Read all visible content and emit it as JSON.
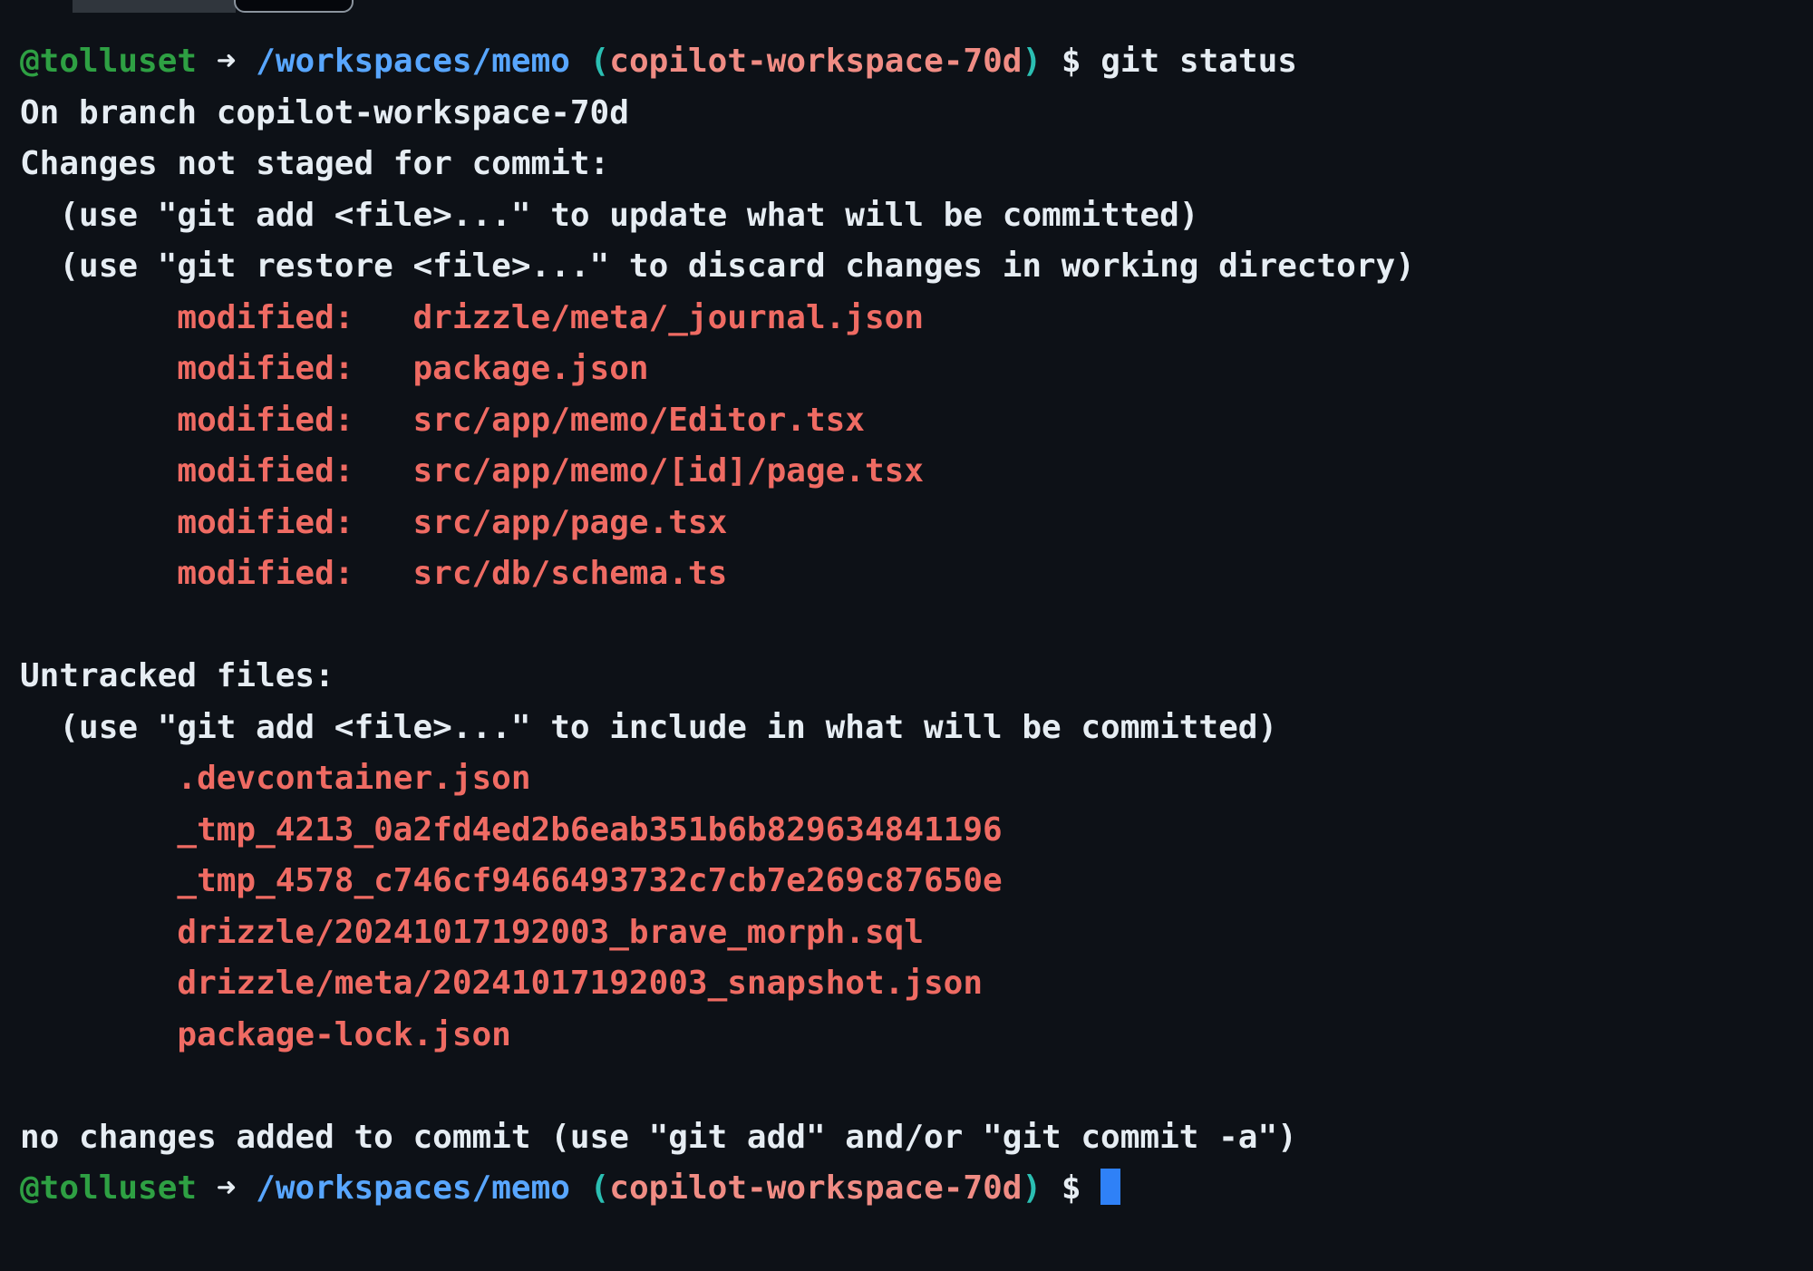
{
  "window": {
    "tabs": [
      {
        "name": "tab-inactive",
        "label": ""
      },
      {
        "name": "tab-active",
        "label": ""
      }
    ]
  },
  "terminal": {
    "background_color": "#0d1117",
    "colors": {
      "user": "#2ea043",
      "path": "#58a6ff",
      "paren": "#2bbfb3",
      "branch": "#f08c84",
      "text": "#e6edf3",
      "file": "#ef6b63",
      "cursor": "#2f81f7"
    },
    "prompt": {
      "user": "@tolluset",
      "arrow": "➜",
      "path": "/workspaces/memo",
      "paren_open": "(",
      "branch": "copilot-workspace-70d",
      "paren_close": ")",
      "dollar": "$"
    },
    "command": "git status",
    "output": {
      "branch_line": "On branch copilot-workspace-70d",
      "changes_header": "Changes not staged for commit:",
      "hint_add_update": "  (use \"git add <file>...\" to update what will be committed)",
      "hint_restore": "  (use \"git restore <file>...\" to discard changes in working directory)",
      "modified_files": [
        {
          "status": "        modified:   ",
          "path": "drizzle/meta/_journal.json"
        },
        {
          "status": "        modified:   ",
          "path": "package.json"
        },
        {
          "status": "        modified:   ",
          "path": "src/app/memo/Editor.tsx"
        },
        {
          "status": "        modified:   ",
          "path": "src/app/memo/[id]/page.tsx"
        },
        {
          "status": "        modified:   ",
          "path": "src/app/page.tsx"
        },
        {
          "status": "        modified:   ",
          "path": "src/db/schema.ts"
        }
      ],
      "untracked_header": "Untracked files:",
      "hint_add_include": "  (use \"git add <file>...\" to include in what will be committed)",
      "untracked_files": [
        "        .devcontainer.json",
        "        _tmp_4213_0a2fd4ed2b6eab351b6b829634841196",
        "        _tmp_4578_c746cf9466493732c7cb7e269c87650e",
        "        drizzle/20241017192003_brave_morph.sql",
        "        drizzle/meta/20241017192003_snapshot.json",
        "        package-lock.json"
      ],
      "footer": "no changes added to commit (use \"git add\" and/or \"git commit -a\")"
    }
  }
}
